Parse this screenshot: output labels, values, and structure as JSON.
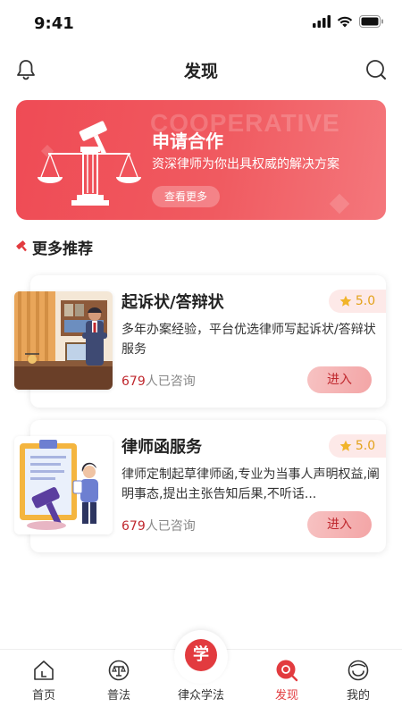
{
  "status_bar": {
    "time": "9:41",
    "icons": [
      "signal-icon",
      "wifi-icon",
      "battery-icon"
    ]
  },
  "nav": {
    "title": "发现",
    "left_icon": "bell-icon",
    "right_icon": "search-icon"
  },
  "banner": {
    "watermark": "COOPERATIVE",
    "title": "申请合作",
    "subtitle": "资深律师为你出具权威的解决方案",
    "button_label": "查看更多"
  },
  "section": {
    "title": "更多推荐",
    "icon": "gavel-icon"
  },
  "cards": [
    {
      "title": "起诉状/答辩状",
      "rating": "5.0",
      "description": "多年办案经验，平台优选律师写起诉状/答辩状服务",
      "count": "679",
      "count_suffix": "人已咨询",
      "button_label": "进入",
      "thumb_icon": "lawyer-office-illustration"
    },
    {
      "title": "律师函服务",
      "rating": "5.0",
      "description": "律师定制起草律师函,专业为当事人声明权益,阐明事态,提出主张告知后果,不听话...",
      "count": "679",
      "count_suffix": "人已咨询",
      "button_label": "进入",
      "thumb_icon": "lawyer-letter-illustration"
    }
  ],
  "tab_bar": {
    "items": [
      {
        "label": "首页",
        "icon": "home-icon",
        "active": false
      },
      {
        "label": "普法",
        "icon": "law-icon",
        "active": false
      },
      {
        "label": "律众学法",
        "icon": "study-icon",
        "center_char": "学",
        "active": false
      },
      {
        "label": "发现",
        "icon": "discover-icon",
        "active": true
      },
      {
        "label": "我的",
        "icon": "profile-icon",
        "active": false
      }
    ]
  },
  "colors": {
    "accent": "#e23b3f",
    "banner_start": "#ef4b55",
    "banner_end": "#f4777c",
    "rating_star": "#f1b42a",
    "count_red": "#c0282e"
  }
}
